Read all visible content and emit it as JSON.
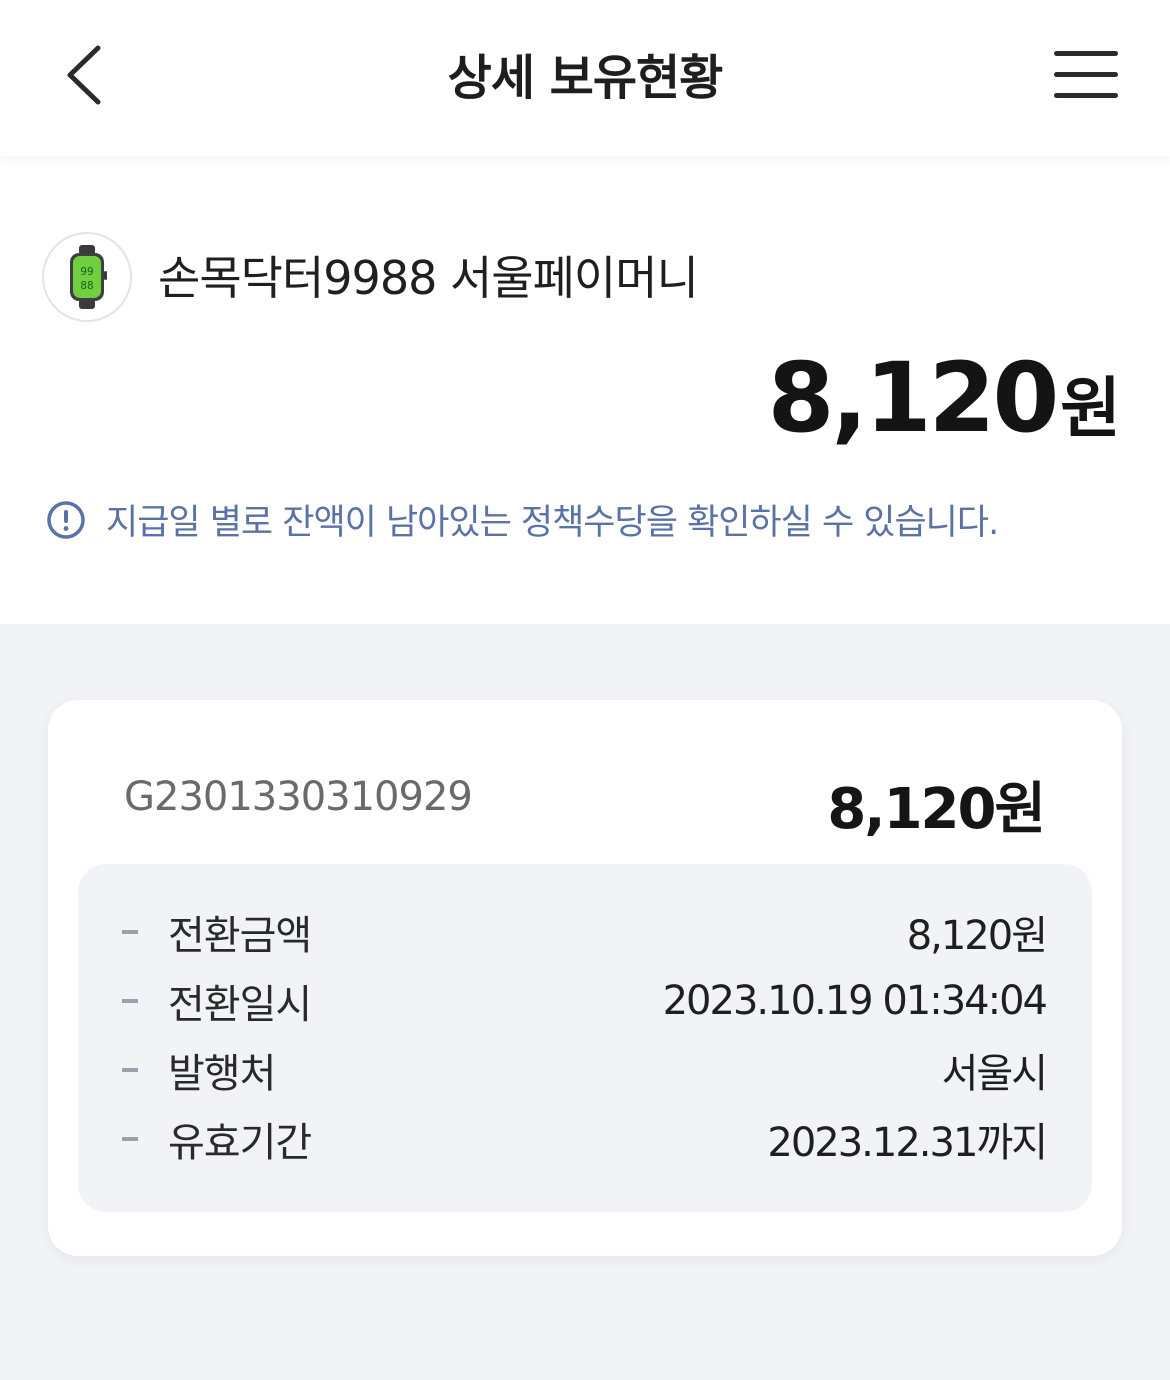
{
  "header": {
    "title": "상세 보유현황",
    "back_icon": "chevron-left-icon",
    "menu_icon": "hamburger-menu-icon"
  },
  "summary": {
    "product_name": "손목닥터9988 서울페이머니",
    "product_icon": "smartwatch-icon",
    "total_value": "8,120",
    "total_unit": "원",
    "notice_icon": "info-circle-icon",
    "notice_text": "지급일 별로 잔액이 남아있는 정책수당을 확인하실 수 있습니다."
  },
  "card": {
    "code": "G2301330310929",
    "amount": "8,120원",
    "details": [
      {
        "label": "전환금액",
        "value": "8,120원"
      },
      {
        "label": "전환일시",
        "value": "2023.10.19 01:34:04"
      },
      {
        "label": "발행처",
        "value": "서울시"
      },
      {
        "label": "유효기간",
        "value": "2023.12.31까지"
      }
    ]
  },
  "colors": {
    "accent_text": "#5a72a6",
    "background": "#f2f3f7",
    "watch_screen": "#6fcf3f"
  }
}
